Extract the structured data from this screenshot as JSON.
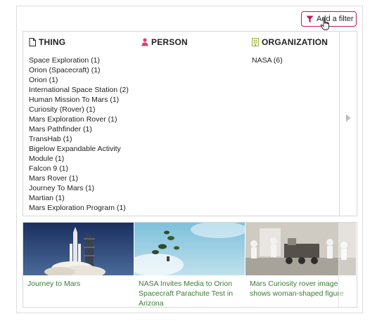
{
  "filter_button": {
    "label": "Add a filter",
    "icon": "funnel-icon",
    "accent": "#c2185b"
  },
  "facets": {
    "thing": {
      "heading": "THING",
      "icon": "document-icon",
      "items": [
        "Space Exploration (1)",
        "Orion (Spacecraft) (1)",
        "Orion (1)",
        "International Space Station (2)",
        "Human Mission To Mars (1)",
        "Curiosity (Rover) (1)",
        "Mars Exploration Rover (1)",
        "Mars Pathfinder (1)",
        "TransHab (1)",
        "Bigelow Expandable Activity",
        "Module (1)",
        "Falcon 9 (1)",
        "Mars Rover (1)",
        "Journey To Mars (1)",
        "Martian (1)",
        "Mars Exploration Program (1)"
      ]
    },
    "person": {
      "heading": "PERSON",
      "icon": "person-icon",
      "icon_color": "#d9436b",
      "items": []
    },
    "organization": {
      "heading": "ORGANIZATION",
      "icon": "building-icon",
      "icon_color": "#9bb33c",
      "items": [
        "NASA (6)"
      ]
    }
  },
  "cards": [
    {
      "title": "Journey to Mars",
      "image": "rocket-launch-image"
    },
    {
      "title": "NASA Invites Media to Orion Spacecraft Parachute Test in Arizona",
      "image": "parachute-test-image"
    },
    {
      "title": "Mars Curiosity rover image shows woman-shaped figure",
      "image": "rover-lab-image"
    }
  ],
  "colors": {
    "link_green": "#3f7a3b",
    "border": "#d8d8d8"
  }
}
